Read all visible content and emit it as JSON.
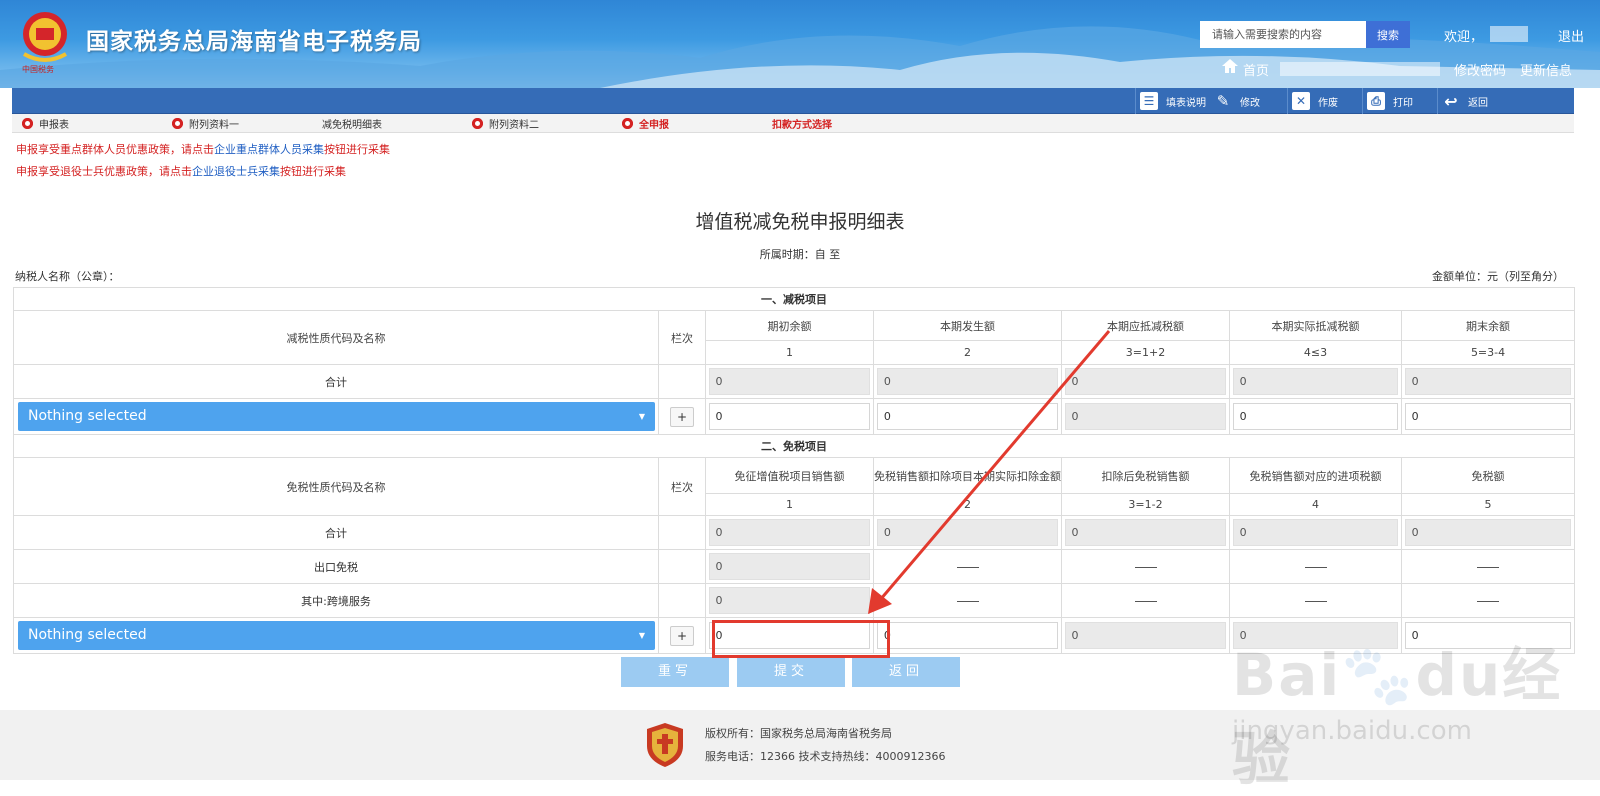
{
  "header": {
    "title": "国家税务总局海南省电子税务局",
    "emblem_caption": "中国税务",
    "search_placeholder": "请输入需要搜索的内容",
    "search_button": "搜索",
    "welcome": "欢迎，",
    "logout": "退出",
    "home": "首页",
    "change_password": "修改密码",
    "update_info": "更新信息"
  },
  "toolbar": {
    "fill_help": "填表说明",
    "modify": "修改",
    "void": "作废",
    "print": "打印",
    "back": "返回"
  },
  "tabs": {
    "main_form": "申报表",
    "attach1": "附列资料一",
    "reduction_detail": "减免税明细表",
    "attach2": "附列资料二",
    "full_declare": "全申报",
    "payment_method": "扣款方式选择"
  },
  "notices": {
    "n1_pre": "申报享受重点群体人员优惠政策，请点击",
    "n1_link": "企业重点群体人员采集",
    "n1_post": "按钮进行采集",
    "n2_pre": "申报享受退役士兵优惠政策，请点击",
    "n2_link": "企业退役士兵采集",
    "n2_post": "按钮进行采集"
  },
  "form": {
    "title": "增值税减免税申报明细表",
    "period": "所属时期：自 至",
    "taxpayer": "纳税人名称（公章）：",
    "unit": "金额单位：元（列至角分）"
  },
  "reduction": {
    "section": "一、减税项目",
    "name_col": "减税性质代码及名称",
    "line_col": "栏次",
    "cols": [
      "期初余额",
      "本期发生额",
      "本期应抵减税额",
      "本期实际抵减税额",
      "期末余额"
    ],
    "col_nums": [
      "1",
      "2",
      "3=1+2",
      "4≤3",
      "5=3-4"
    ],
    "total_label": "合计",
    "total_values": [
      "0",
      "0",
      "0",
      "0",
      "0"
    ],
    "select_text": "Nothing selected",
    "plus": "+",
    "row_values": [
      "0",
      "0",
      "0",
      "0",
      "0"
    ]
  },
  "exemption": {
    "section": "二、免税项目",
    "name_col": "免税性质代码及名称",
    "line_col": "栏次",
    "cols": [
      "免征增值税项目销售额",
      "免税销售额扣除项目本期实际扣除金额",
      "扣除后免税销售额",
      "免税销售额对应的进项税额",
      "免税额"
    ],
    "col_nums": [
      "1",
      "2",
      "3=1-2",
      "4",
      "5"
    ],
    "total_label": "合计",
    "total_values": [
      "0",
      "0",
      "0",
      "0",
      "0"
    ],
    "export_label": "出口免税",
    "export_value": "0",
    "cross_label": "其中:跨境服务",
    "cross_value": "0",
    "select_text": "Nothing selected",
    "plus": "+",
    "row_values": [
      "0",
      "0",
      "0",
      "0",
      "0"
    ]
  },
  "actions": {
    "reset": "重写",
    "submit": "提交",
    "back": "返回"
  },
  "footer": {
    "copyright": "版权所有：国家税务总局海南省税务局",
    "phone": "服务电话：12366 技术支持热线：4000912366"
  },
  "watermark": {
    "main": "Bai🐾du经验",
    "sub": "jingyan.baidu.com"
  },
  "colors": {
    "header_blue": "#2f86d6",
    "toolbar_blue": "#356cb7",
    "select_blue": "#4ea3ee",
    "button_blue": "#9ccbf2",
    "annotation_red": "#e23a2e"
  }
}
